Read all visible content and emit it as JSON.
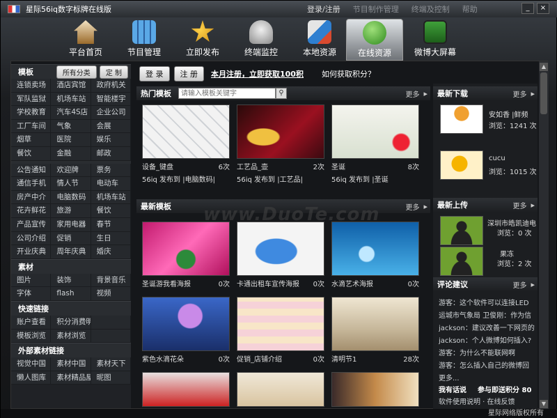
{
  "app": {
    "title": "星际56iq数字标牌在线版"
  },
  "titlebar": {
    "login": "登录/注册",
    "program_manager": "节目制作管理",
    "terminal": "终端及控制",
    "help": "帮助",
    "minimize": "_",
    "close": "×"
  },
  "toolbar": {
    "items": [
      {
        "label": "平台首页"
      },
      {
        "label": "节目管理"
      },
      {
        "label": "立即发布"
      },
      {
        "label": "终端监控"
      },
      {
        "label": "本地资源"
      },
      {
        "label": "在线资源"
      },
      {
        "label": "微博大屏幕"
      }
    ]
  },
  "sidebar": {
    "template_title": "模板",
    "all_categories": "所有分类",
    "customize": "定 制",
    "grid1": [
      "连锁卖场",
      "酒店宾馆",
      "政府机关",
      "军队监狱",
      "机场车站",
      "智能楼宇",
      "学校教育",
      "汽车4S店",
      "企业公司",
      "工厂车间",
      "气象",
      "会展",
      "烟草",
      "医院",
      "娱乐",
      "餐饮",
      "金融",
      "邮政"
    ],
    "grid2": [
      "公告通知",
      "欢迎牌",
      "票务",
      "通信手机",
      "情人节",
      "电动车",
      "房产中介",
      "电脑数码",
      "机场车站",
      "花卉鲜花",
      "旅游",
      "餐饮",
      "产品宣传",
      "家用电器",
      "春节",
      "公司介绍",
      "促销",
      "生日",
      "开业庆典",
      "周年庆典",
      "婚庆"
    ],
    "material_title": "素材",
    "grid3": [
      "图片",
      "装饰",
      "背景音乐",
      "字体",
      "flash",
      "视频"
    ],
    "links_title": "快速链接",
    "grid4": [
      "账户查看",
      "积分消费明细",
      "",
      "模板浏览",
      "素材浏览",
      ""
    ],
    "external_title": "外部素材链接",
    "grid5": [
      "视觉中国",
      "素材中国",
      "素材天下",
      "懒人图库",
      "素材精品屋",
      "昵图"
    ]
  },
  "topbar": {
    "login": "登 录",
    "register": "注 册",
    "promo": "本月注册，立即获取100积",
    "how": "如何获取积分？"
  },
  "hot": {
    "title": "热门模板",
    "search_placeholder": "请输入模板关键字",
    "more": "更多",
    "tiles": [
      {
        "name": "设备_键盘",
        "count": "6次",
        "sub": "56iq 发布到 |电脑数码|"
      },
      {
        "name": "工艺品_壶",
        "count": "2次",
        "sub": "56iq 发布到 |工艺品|"
      },
      {
        "name": "圣诞",
        "count": "8次",
        "sub": "56iq 发布到 |圣诞"
      }
    ]
  },
  "latest": {
    "title": "最新模板",
    "more": "更多",
    "tiles": [
      {
        "name": "圣诞游我看海报",
        "count": "0次"
      },
      {
        "name": "卡通出租车宣传海报",
        "count": "0次"
      },
      {
        "name": "水滴艺术海报",
        "count": "0次"
      },
      {
        "name": "紫色水滴花朵",
        "count": "0次"
      },
      {
        "name": "促销_店铺介绍",
        "count": "0次"
      },
      {
        "name": "清明节1",
        "count": "28次"
      }
    ]
  },
  "downloads": {
    "title": "最新下载",
    "more": "更多",
    "items": [
      {
        "name": "安如香 |鲜频",
        "views": "浏览：1241 次"
      },
      {
        "name": "cucu",
        "views": "浏览：1015 次"
      }
    ]
  },
  "uploads": {
    "title": "最新上传",
    "more": "更多",
    "items": [
      {
        "name": "深圳市皓凯迪电",
        "views": "浏览：0 次"
      },
      {
        "name": "果冻",
        "views": "浏览：2 次"
      }
    ]
  },
  "comments": {
    "title": "评论建议",
    "more": "更多",
    "items": [
      "游客：这个软件可以连接LED",
      "运城市气象局 卫俊刚：作为信",
      "jackson：建议改善一下网页的",
      "jackson：个人微博如何插入?",
      "游客：为什么不能联网啊",
      "游客：怎么插入自己的微博回"
    ],
    "extra": "更多...",
    "my_comments": "我有话说",
    "participate": "参与即送积分 80",
    "feedback": "软件使用说明 · 在线反馈"
  },
  "statusbar": {
    "text": "星际网络版权所有"
  },
  "watermark": {
    "text": "www.DuoTe.com"
  },
  "colors": {
    "accent": "#2a8fd8",
    "panel": "#202226",
    "bg": "#15171a"
  }
}
